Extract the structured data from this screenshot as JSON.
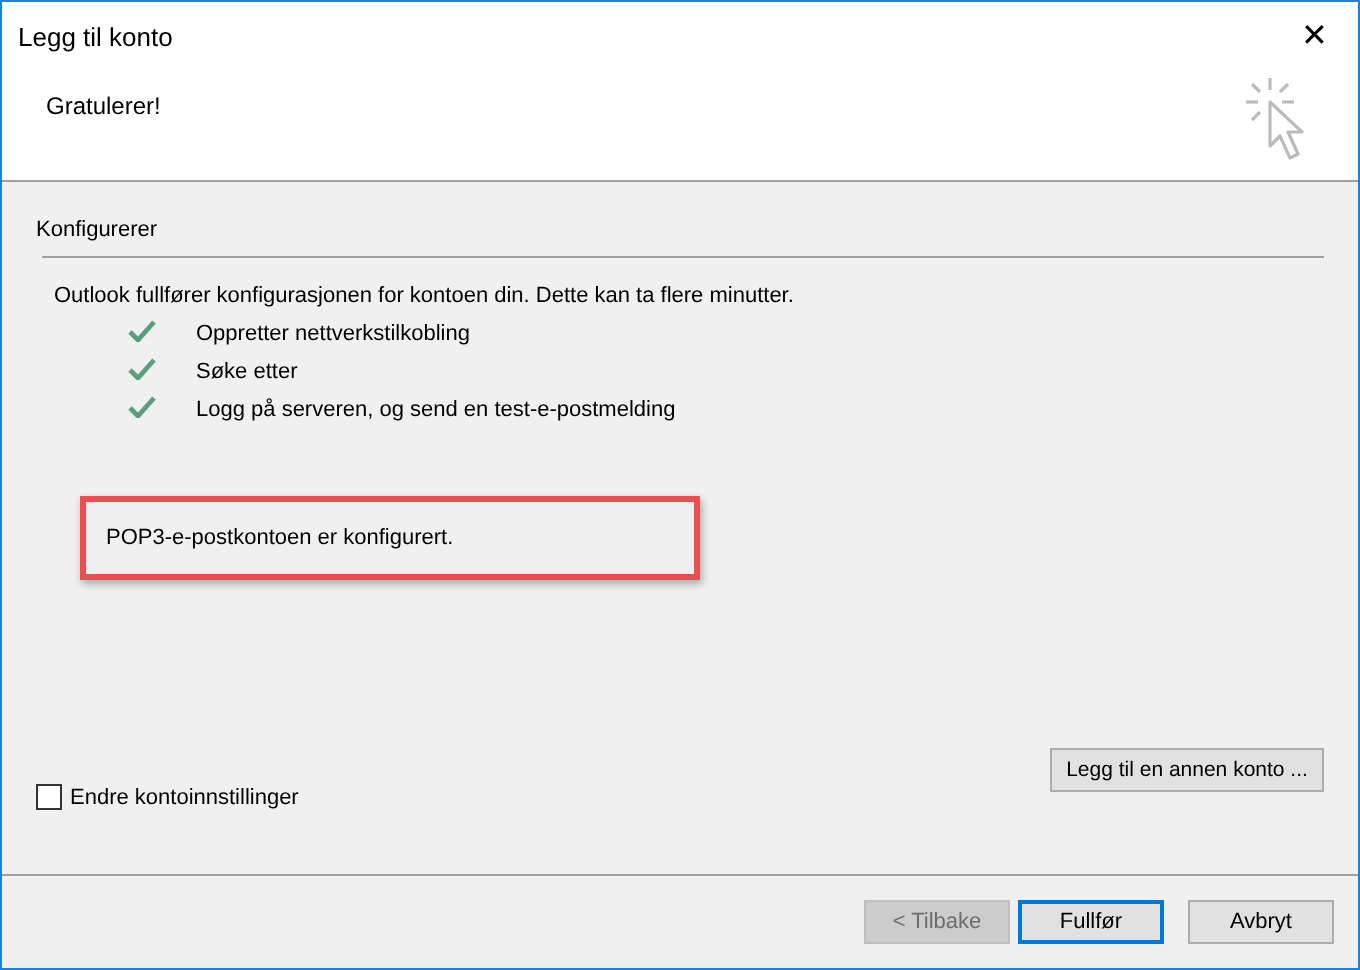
{
  "window": {
    "title": "Legg til konto",
    "close": "✕"
  },
  "header": {
    "title": "Gratulerer!"
  },
  "section": {
    "title": "Konfigurerer",
    "intro": "Outlook fullfører konfigurasjonen for kontoen din. Dette kan ta flere minutter.",
    "steps": [
      {
        "label": "Oppretter nettverkstilkobling",
        "done": true
      },
      {
        "label": "Søke etter",
        "done": true
      },
      {
        "label": "Logg på serveren, og send en test-e-postmelding",
        "done": true
      }
    ],
    "result": {
      "text": "POP3-e-postkontoen er konfigurert.",
      "highlighted": true
    }
  },
  "change_settings": {
    "label": "Endre kontoinnstillinger",
    "checked": false
  },
  "add_account_button": "Legg til en annen konto ...",
  "buttons": [
    {
      "label": "< Tilbake",
      "disabled": true,
      "default": false
    },
    {
      "label": "Fullfør",
      "disabled": false,
      "default": true
    },
    {
      "label": "Avbryt",
      "disabled": false,
      "default": false
    }
  ]
}
